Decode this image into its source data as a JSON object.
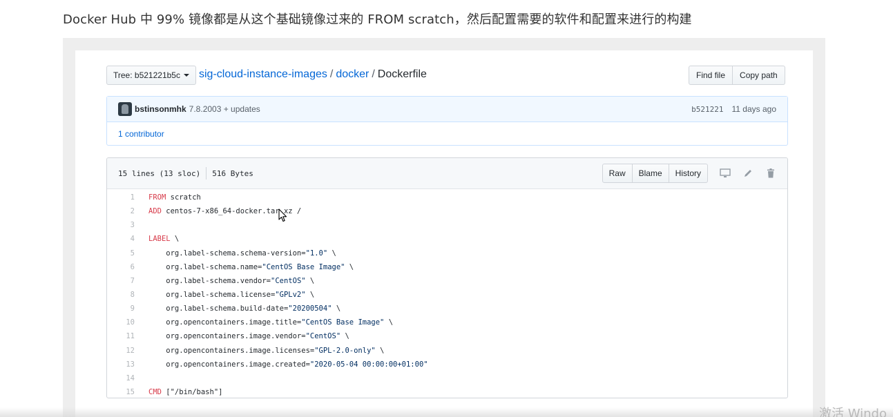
{
  "caption": "Docker Hub 中 99% 镜像都是从这个基础镜像过来的 FROM scratch，然后配置需要的软件和配置来进行的构建",
  "tree_button": "Tree: b521221b5c",
  "breadcrumb": {
    "repo": "sig-cloud-instance-images",
    "folder": "docker",
    "file": "Dockerfile",
    "separator": "/"
  },
  "top_actions": {
    "find_file": "Find file",
    "copy_path": "Copy path"
  },
  "commit": {
    "author": "bstinsonmhk",
    "message": "7.8.2003 + updates",
    "sha": "b521221",
    "age": "11 days ago"
  },
  "contributors": "1 contributor",
  "file_info": {
    "lines": "15 lines (13 sloc)",
    "size": "516 Bytes"
  },
  "file_actions": {
    "raw": "Raw",
    "blame": "Blame",
    "history": "History"
  },
  "icons": [
    "desktop-icon",
    "pencil-icon",
    "trash-icon",
    "mouse-cursor-icon"
  ],
  "code_lines": [
    {
      "n": "1",
      "kw": "FROM",
      "rest": " scratch"
    },
    {
      "n": "2",
      "kw": "ADD",
      "rest": " centos-7-x86_64-docker.tar.xz /"
    },
    {
      "n": "3",
      "kw": "",
      "rest": ""
    },
    {
      "n": "4",
      "kw": "LABEL",
      "rest": " \\"
    },
    {
      "n": "5",
      "kw": "",
      "pre": "    org.label-schema.schema-version=",
      "str": "\"1.0\"",
      "post": " \\"
    },
    {
      "n": "6",
      "kw": "",
      "pre": "    org.label-schema.name=",
      "str": "\"CentOS Base Image\"",
      "post": " \\"
    },
    {
      "n": "7",
      "kw": "",
      "pre": "    org.label-schema.vendor=",
      "str": "\"CentOS\"",
      "post": " \\"
    },
    {
      "n": "8",
      "kw": "",
      "pre": "    org.label-schema.license=",
      "str": "\"GPLv2\"",
      "post": " \\"
    },
    {
      "n": "9",
      "kw": "",
      "pre": "    org.label-schema.build-date=",
      "str": "\"20200504\"",
      "post": " \\"
    },
    {
      "n": "10",
      "kw": "",
      "pre": "    org.opencontainers.image.title=",
      "str": "\"CentOS Base Image\"",
      "post": " \\"
    },
    {
      "n": "11",
      "kw": "",
      "pre": "    org.opencontainers.image.vendor=",
      "str": "\"CentOS\"",
      "post": " \\"
    },
    {
      "n": "12",
      "kw": "",
      "pre": "    org.opencontainers.image.licenses=",
      "str": "\"GPL-2.0-only\"",
      "post": " \\"
    },
    {
      "n": "13",
      "kw": "",
      "pre": "    org.opencontainers.image.created=",
      "str": "\"2020-05-04 00:00:00+01:00\"",
      "post": ""
    },
    {
      "n": "14",
      "kw": "",
      "rest": ""
    },
    {
      "n": "15",
      "kw": "CMD",
      "rest": " [\"/bin/bash\"]"
    }
  ],
  "watermark": "激活 Windo"
}
